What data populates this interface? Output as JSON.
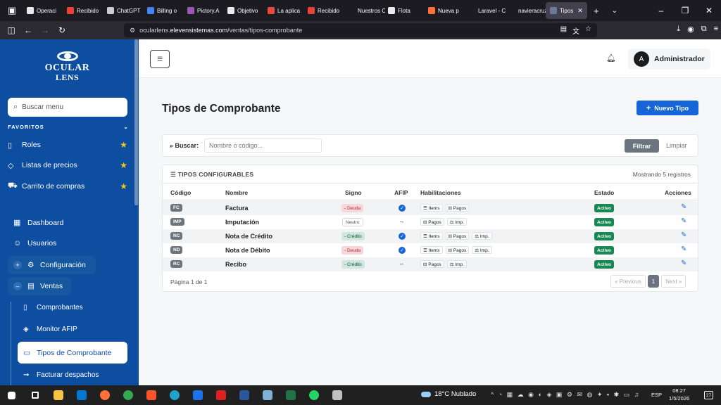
{
  "browser": {
    "tabs": [
      {
        "label": "Operaci",
        "color": "#e8eaed"
      },
      {
        "label": "Recibido",
        "color": "#ea4335"
      },
      {
        "label": "ChatGPT",
        "color": "#cccccc"
      },
      {
        "label": "Billing o",
        "color": "#4285f4"
      },
      {
        "label": "Pictory.A",
        "color": "#9b59b6"
      },
      {
        "label": "Objetivo",
        "color": "#e8eaed"
      },
      {
        "label": "La aplica",
        "color": "#e74c3c"
      },
      {
        "label": "Recibido",
        "color": "#ea4335"
      },
      {
        "label": "Nuestros Cli",
        "color": "#1c1b22"
      },
      {
        "label": "Flota",
        "color": "#e8eaed"
      },
      {
        "label": "Nueva p",
        "color": "#ff7139"
      },
      {
        "label": "Laravel - Cer",
        "color": "#1c1b22"
      },
      {
        "label": "navieracruzd",
        "color": "#1c1b22"
      }
    ],
    "active_tab": "Tipos",
    "url_prefix": "ocularlens.",
    "url_host": "elevensistemas.com",
    "url_path": "/ventas/tipos-comprobante"
  },
  "sidebar": {
    "logo_line1": "OCULAR",
    "logo_line2": "LENS",
    "search_placeholder": "Buscar menu",
    "favorites_header": "FAVORITOS",
    "favorites": [
      {
        "label": "Roles",
        "icon": "file-icon"
      },
      {
        "label": "Listas de precios",
        "icon": "tag-icon"
      },
      {
        "label": "Carrito de compras",
        "icon": "cart-icon"
      }
    ],
    "items": {
      "dashboard": "Dashboard",
      "usuarios": "Usuarios",
      "configuracion": "Configuración",
      "ventas": "Ventas"
    },
    "ventas_sub": {
      "comprobantes": "Comprobantes",
      "monitor_afip": "Monitor AFIP",
      "tipos_comprobante": "Tipos de Comprobante",
      "facturar_despachos": "Facturar despachos"
    }
  },
  "header": {
    "user_initial": "A",
    "user_name": "Administrador"
  },
  "page": {
    "title": "Tipos de Comprobante",
    "new_button": "Nuevo Tipo",
    "filter": {
      "label": "Buscar:",
      "placeholder": "Nombre o código...",
      "filter_button": "Filtrar",
      "clear_link": "Limpiar"
    },
    "table": {
      "title": "TIPOS CONFIGURABLES",
      "count": "Mostrando 5 registros",
      "columns": {
        "codigo": "Código",
        "nombre": "Nombre",
        "signo": "Signo",
        "afip": "AFIP",
        "habilitaciones": "Habilitaciones",
        "estado": "Estado",
        "acciones": "Acciones"
      },
      "rows": [
        {
          "code": "FC",
          "name": "Factura",
          "sign": "- Deuda",
          "sign_type": "deuda",
          "afip": true,
          "habs": [
            "☰ Items",
            "⊟ Pagos"
          ],
          "status": "Activo"
        },
        {
          "code": "IMP",
          "name": "Imputación",
          "sign": "Neutro",
          "sign_type": "neutro",
          "afip": false,
          "habs": [
            "⊟ Pagos",
            "⚖ Imp."
          ],
          "status": "Activo"
        },
        {
          "code": "NC",
          "name": "Nota de Crédito",
          "sign": "- Crédito",
          "sign_type": "credito",
          "afip": true,
          "habs": [
            "☰ Items",
            "⊟ Pagos",
            "⚖ Imp."
          ],
          "status": "Activo"
        },
        {
          "code": "ND",
          "name": "Nota de Débito",
          "sign": "- Deuda",
          "sign_type": "deuda",
          "afip": true,
          "habs": [
            "☰ Items",
            "⊟ Pagos",
            "⚖ Imp."
          ],
          "status": "Activo"
        },
        {
          "code": "RC",
          "name": "Recibo",
          "sign": "- Crédito",
          "sign_type": "credito",
          "afip": false,
          "habs": [
            "⊟ Pagos",
            "⚖ Imp."
          ],
          "status": "Activo"
        }
      ],
      "afip_no_value": "–",
      "pagination_text": "Página 1 de 1",
      "pager": {
        "prev": "« Previous",
        "current": "1",
        "next": "Next »"
      }
    }
  },
  "taskbar": {
    "weather": "18°C Nublado",
    "language": "ESP",
    "time": "08:27",
    "date": "1/5/2026",
    "notifications": "27"
  }
}
